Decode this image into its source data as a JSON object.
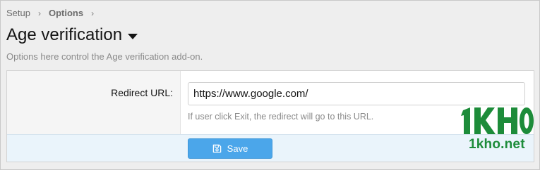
{
  "breadcrumb": {
    "items": [
      "Setup",
      "Options"
    ],
    "separator": "›"
  },
  "page": {
    "title": "Age verification",
    "description": "Options here control the Age verification add-on."
  },
  "form": {
    "redirect_label": "Redirect URL:",
    "redirect_value": "https://www.google.com/",
    "redirect_hint": "If user click Exit, the redirect will go to this URL.",
    "save_label": "Save"
  },
  "icons": {
    "breadcrumb_separator": "chevron-right-icon",
    "title_dropdown": "caret-down-icon",
    "save": "floppy-disk-icon"
  },
  "watermark": {
    "brand": "1KHO",
    "domain": "1kho.net",
    "color": "#1d8c3a"
  },
  "colors": {
    "primary_button": "#4ba6ea",
    "footer_background": "#eaf4fb",
    "label_column": "#f5f5f5"
  }
}
